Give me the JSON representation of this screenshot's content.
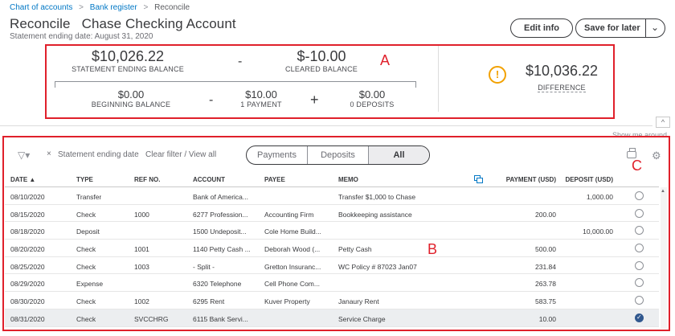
{
  "breadcrumb": {
    "items": [
      "Chart of accounts",
      "Bank register",
      "Reconcile"
    ],
    "separator": ">"
  },
  "header": {
    "title": "Reconcile",
    "account": "Chase Checking Account",
    "subtitle": "Statement ending date: August 31, 2020",
    "edit_label": "Edit info",
    "save_label": "Save for later",
    "save_menu_icon": "chevron-down-icon"
  },
  "annotations": {
    "a": "A",
    "b": "B",
    "c": "C",
    "color": "#e0202b"
  },
  "summary": {
    "statement_ending_balance": {
      "value": "$10,026.22",
      "label": "STATEMENT ENDING BALANCE"
    },
    "minus_1": "-",
    "cleared_balance": {
      "value": "$-10.00",
      "label": "CLEARED BALANCE"
    },
    "beginning_balance": {
      "value": "$0.00",
      "label": "BEGINNING BALANCE"
    },
    "minus_2": "-",
    "payments": {
      "value": "$10.00",
      "label": "1 PAYMENT"
    },
    "plus": "+",
    "deposits": {
      "value": "$0.00",
      "label": "0 DEPOSITS"
    },
    "difference": {
      "value": "$10,036.22",
      "label": "DIFFERENCE",
      "icon": "warning-icon",
      "icon_glyph": "!",
      "icon_color": "#f2a100"
    }
  },
  "collapse_glyph": "^",
  "show_more_text": "Show me around",
  "filter": {
    "filter_glyph": "▽▾",
    "remove_glyph": "×",
    "chip": "Statement ending date",
    "clear": "Clear filter / View all"
  },
  "tabs": [
    {
      "label": "Payments",
      "active": false
    },
    {
      "label": "Deposits",
      "active": false
    },
    {
      "label": "All",
      "active": true
    }
  ],
  "gear_glyph": "⚙",
  "table": {
    "headers": {
      "date": "DATE ▲",
      "type": "TYPE",
      "ref": "REF NO.",
      "account": "ACCOUNT",
      "payee": "PAYEE",
      "memo": "MEMO",
      "payment": "PAYMENT (USD)",
      "deposit": "DEPOSIT (USD)"
    },
    "rows": [
      {
        "date": "08/10/2020",
        "type": "Transfer",
        "ref": "",
        "account": "Bank of America...",
        "payee": "",
        "memo": "Transfer $1,000 to Chase",
        "payment": "",
        "deposit": "1,000.00",
        "checked": false
      },
      {
        "date": "08/15/2020",
        "type": "Check",
        "ref": "1000",
        "account": "6277 Profession...",
        "payee": "Accounting Firm",
        "memo": "Bookkeeping assistance",
        "payment": "200.00",
        "deposit": "",
        "checked": false
      },
      {
        "date": "08/18/2020",
        "type": "Deposit",
        "ref": "",
        "account": "1500 Undeposit...",
        "payee": "Cole Home Build...",
        "memo": "",
        "payment": "",
        "deposit": "10,000.00",
        "checked": false
      },
      {
        "date": "08/20/2020",
        "type": "Check",
        "ref": "1001",
        "account": "1140 Petty Cash ...",
        "payee": "Deborah Wood (...",
        "memo": "Petty Cash",
        "payment": "500.00",
        "deposit": "",
        "checked": false
      },
      {
        "date": "08/25/2020",
        "type": "Check",
        "ref": "1003",
        "account": "- Split -",
        "payee": "Gretton Insuranc...",
        "memo": "WC Policy # 87023 Jan07",
        "payment": "231.84",
        "deposit": "",
        "checked": false
      },
      {
        "date": "08/29/2020",
        "type": "Expense",
        "ref": "",
        "account": "6320 Telephone",
        "payee": "Cell Phone Com...",
        "memo": "",
        "payment": "263.78",
        "deposit": "",
        "checked": false
      },
      {
        "date": "08/30/2020",
        "type": "Check",
        "ref": "1002",
        "account": "6295 Rent",
        "payee": "Kuver Property",
        "memo": "Janaury Rent",
        "payment": "583.75",
        "deposit": "",
        "checked": false
      },
      {
        "date": "08/31/2020",
        "type": "Check",
        "ref": "SVCCHRG",
        "account": "6115 Bank Servi...",
        "payee": "",
        "memo": "Service Charge",
        "payment": "10.00",
        "deposit": "",
        "checked": true
      }
    ]
  },
  "scroll_up_glyph": "▲"
}
